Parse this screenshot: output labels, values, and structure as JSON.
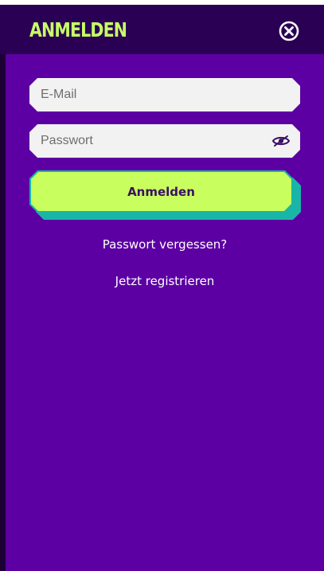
{
  "header": {
    "title": "ANMELDEN",
    "close_icon": "close-circle-icon"
  },
  "form": {
    "email": {
      "value": "",
      "placeholder": "E-Mail"
    },
    "password": {
      "value": "",
      "placeholder": "Passwort",
      "toggle_icon": "eye-slash-icon"
    },
    "submit_label": "Anmelden"
  },
  "links": {
    "forgot_password": "Passwort vergessen?",
    "register": "Jetzt registrieren"
  },
  "colors": {
    "header_bg": "#2a0054",
    "panel_bg": "#5c00a3",
    "accent_lime": "#c8ff5e",
    "accent_teal": "#19b6a8",
    "button_text": "#3a0f63"
  }
}
